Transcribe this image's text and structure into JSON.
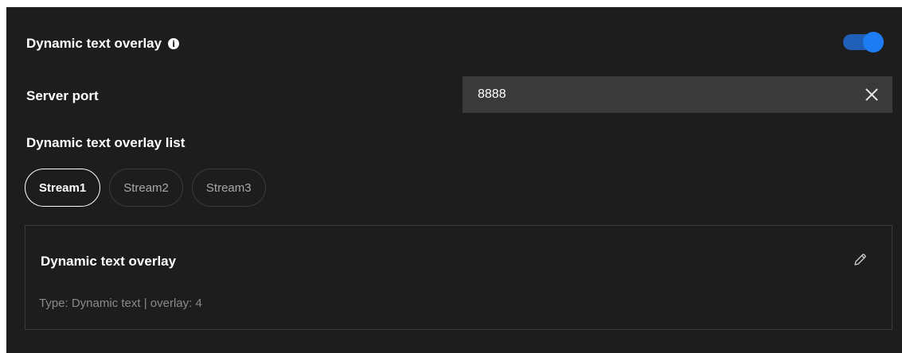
{
  "overlay_setting": {
    "title": "Dynamic text overlay",
    "info_icon": "info-icon",
    "enabled": true,
    "toggle_color": "#1e7cf2"
  },
  "server_port": {
    "label": "Server port",
    "value": "8888",
    "clear_icon": "close-icon"
  },
  "overlay_list": {
    "label": "Dynamic text overlay list",
    "tabs": [
      {
        "label": "Stream1",
        "active": true
      },
      {
        "label": "Stream2",
        "active": false
      },
      {
        "label": "Stream3",
        "active": false
      }
    ]
  },
  "card": {
    "title": "Dynamic text overlay",
    "subtitle": "Type: Dynamic text | overlay: 4",
    "edit_icon": "pencil-icon"
  },
  "colors": {
    "background": "#1d1d1d",
    "input_background": "#3a3a3a",
    "accent": "#1e7cf2",
    "muted_text": "#8a8a8a"
  }
}
